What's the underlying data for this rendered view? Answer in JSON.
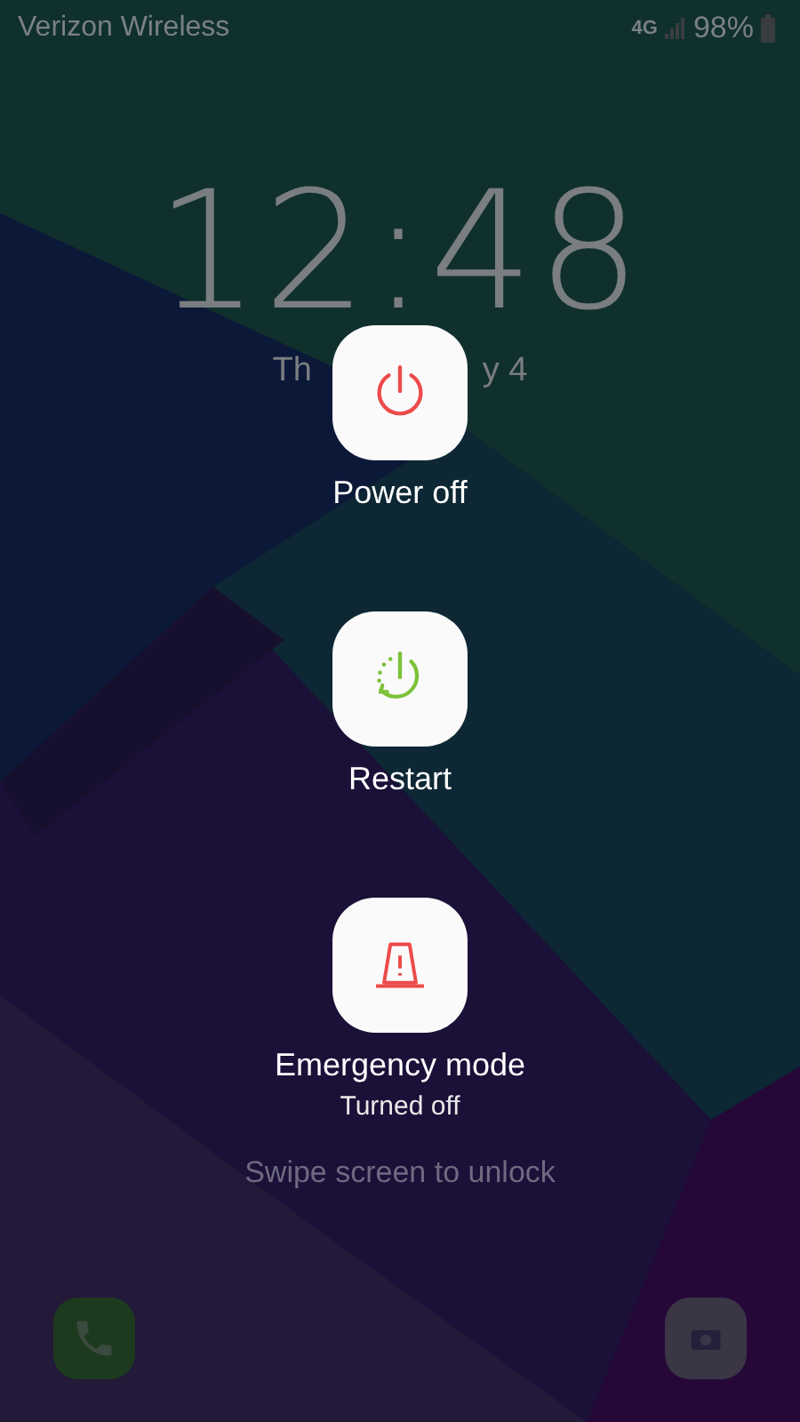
{
  "status_bar": {
    "carrier": "Verizon Wireless",
    "network": "4G",
    "battery": "98%"
  },
  "lock_screen": {
    "time": "12:48",
    "date_parts": [
      "Th",
      "y 4"
    ],
    "hint": "Swipe screen to unlock",
    "shortcuts": [
      {
        "kind": "phone"
      },
      {
        "kind": "camera"
      }
    ]
  },
  "power_menu": {
    "options": [
      {
        "kind": "power_off",
        "label": "Power off"
      },
      {
        "kind": "restart",
        "label": "Restart"
      },
      {
        "kind": "emergency",
        "label": "Emergency mode",
        "status": "Turned off"
      }
    ]
  }
}
